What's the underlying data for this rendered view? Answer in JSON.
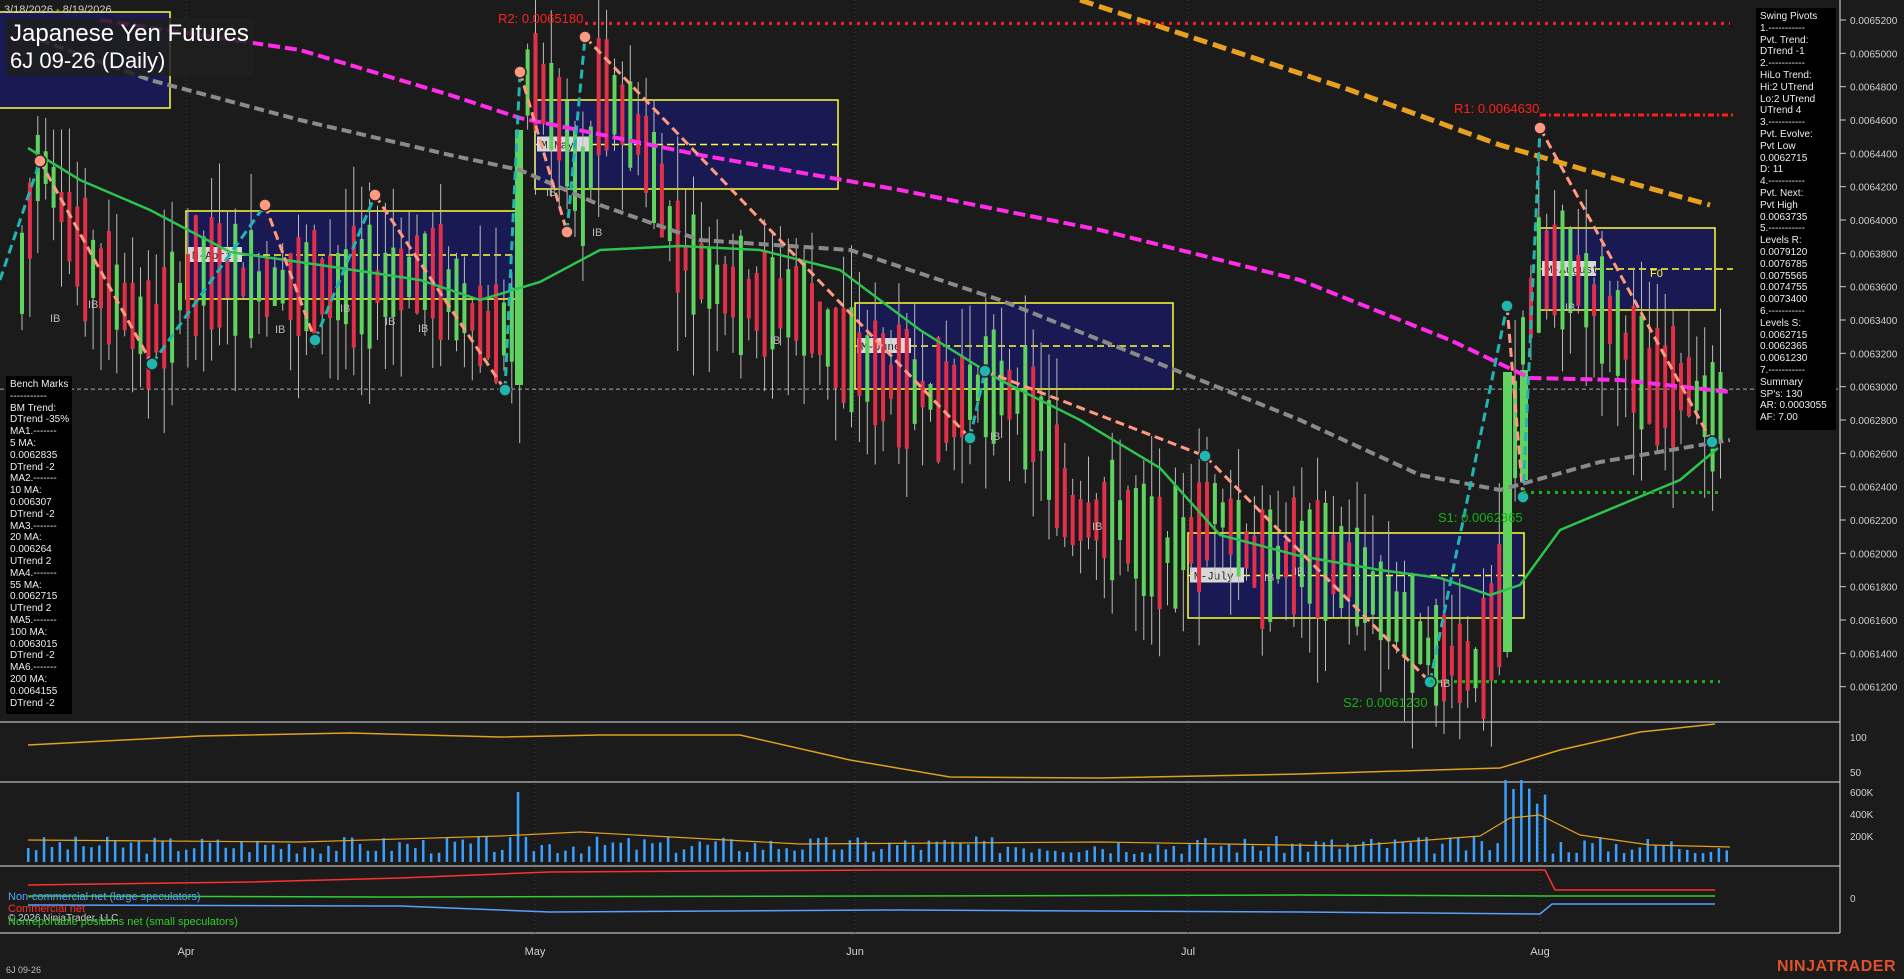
{
  "window": {
    "date_range": "3/18/2026 - 8/19/2026",
    "title": "Japanese Yen Futures",
    "subtitle": "6J 09-26 (Daily)",
    "footer_symbol": "6J 09-26",
    "copyright": "© 2026 NinjaTrader, LLC",
    "brand": "NINJATRADER"
  },
  "colors": {
    "background": "#1b1b1b",
    "up_candle": "#5fd25f",
    "down_candle": "#e0304a",
    "ma5": "#2ec24f",
    "ma200": "#e8a020",
    "ma100": "#ff2ce8",
    "ma55": "#8a8a8a",
    "swing_up": "#21b5b0",
    "swing_down": "#ff9a80",
    "pivot_r": "#ff1e1e",
    "pivot_s": "#16b416",
    "range_box": "#ffff33",
    "range_fill": "#19195e"
  },
  "levels": {
    "r2": "R2: 0.0065180",
    "r1": "R1: 0.0064630",
    "s1": "S1: 0.0062365",
    "s2": "S2: 0.0061230",
    "f0": "F0"
  },
  "range_boxes": [
    "M-April",
    "M-May",
    "M-June",
    "M-July",
    "M-August"
  ],
  "ib_label": "IB",
  "swing_panel": [
    "Swing Pivots",
    "1.-----------",
    "Pvt. Trend:",
    "DTrend -1",
    "2.-----------",
    "HiLo Trend:",
    "Hi:2 UTrend",
    "Lo:2 UTrend",
    "UTrend 4",
    "3.-----------",
    "Pvt. Evolve:",
    "Pvt Low",
    "0.0062715",
    "D: 11",
    "4.-----------",
    "Pvt. Next:",
    "Pvt High",
    "0.0063735",
    "5.-----------",
    "Levels R:",
    "0.0079120",
    "0.0076785",
    "0.0075565",
    "0.0074755",
    "0.0073400",
    "6.-----------",
    "Levels S:",
    "0.0062715",
    "0.0062365",
    "0.0061230",
    "7.-----------",
    "Summary",
    "SP's: 130",
    "AR: 0.0003055",
    "AF: 7.00"
  ],
  "bench_panel": [
    "Bench Marks",
    "-----------",
    "BM Trend:",
    "DTrend -35%",
    "MA1.-------",
    "5 MA:",
    "0.0062835",
    "DTrend -2",
    "MA2.-------",
    "10 MA:",
    "0.006307",
    "DTrend -2",
    "MA3.-------",
    "20 MA:",
    "0.006264",
    "UTrend 2",
    "MA4.-------",
    "55 MA:",
    "0.0062715",
    "UTrend 2",
    "MA5.-------",
    "100 MA:",
    "0.0063015",
    "DTrend -2",
    "MA6.-------",
    "200 MA:",
    "0.0064155",
    "DTrend -2"
  ],
  "cot_legend": {
    "noncommercial": "Non-commercial net (large speculators)",
    "commercial": "Commercial net",
    "nonreportable": "Nonreportable positions net (small speculators)"
  },
  "chart_data": [
    {
      "type": "candlestick",
      "title": "Japanese Yen Futures",
      "subtitle": "6J 09-26 (Daily)",
      "x_labels": [
        "Apr",
        "May",
        "Jun",
        "Jul",
        "Aug"
      ],
      "y_ticks": [
        "0.0065200",
        "0.0065000",
        "0.0064800",
        "0.0064600",
        "0.0064400",
        "0.0064200",
        "0.0064000",
        "0.0063800",
        "0.0063600",
        "0.0063400",
        "0.0063200",
        "0.0063000",
        "0.0062800",
        "0.0062600",
        "0.0062400",
        "0.0062200",
        "0.0062000",
        "0.0061800",
        "0.0061600",
        "0.0061400",
        "0.0061200"
      ],
      "ylim": [
        0.0061,
        0.006532
      ],
      "pivot_lines": {
        "R2": 0.006518,
        "R1": 0.006463,
        "S1": 0.0062365,
        "S2": 0.006123
      },
      "last_close": 0.0062985,
      "ma_100_last": 0.0063015,
      "ma_200_last": 0.0064155,
      "ma_55_last": 0.0062715,
      "ma_5_last": 0.0062835,
      "grid": false
    },
    {
      "type": "line",
      "name": "oscillator",
      "y_ticks": [
        "100",
        "50"
      ]
    },
    {
      "type": "bar",
      "name": "volume",
      "y_ticks": [
        "600K",
        "400K",
        "200K"
      ]
    },
    {
      "type": "line",
      "name": "COT",
      "y_ticks": [
        "0"
      ],
      "series": [
        {
          "name": "Non-commercial net (large speculators)"
        },
        {
          "name": "Commercial net"
        },
        {
          "name": "Nonreportable positions net (small speculators)"
        }
      ]
    }
  ]
}
